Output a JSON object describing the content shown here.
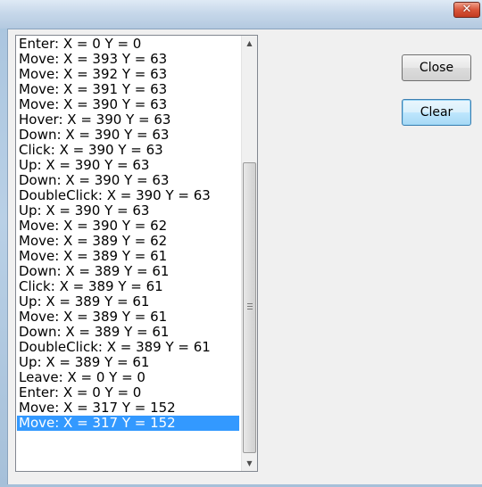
{
  "window": {
    "close_glyph": "✕"
  },
  "log": {
    "items": [
      "Enter: X = 0 Y = 0",
      "Move: X = 393 Y = 63",
      "Move: X = 392 Y = 63",
      "Move: X = 391 Y = 63",
      "Move: X = 390 Y = 63",
      "Hover: X = 390 Y = 63",
      "Down: X = 390 Y = 63",
      "Click: X = 390 Y = 63",
      "Up: X = 390 Y = 63",
      "Down: X = 390 Y = 63",
      "DoubleClick: X = 390 Y = 63",
      "Up: X = 390 Y = 63",
      "Move: X = 390 Y = 62",
      "Move: X = 389 Y = 62",
      "Move: X = 389 Y = 61",
      "Down: X = 389 Y = 61",
      "Click: X = 389 Y = 61",
      "Up: X = 389 Y = 61",
      "Move: X = 389 Y = 61",
      "Down: X = 389 Y = 61",
      "DoubleClick: X = 389 Y = 61",
      "Up: X = 389 Y = 61",
      "Leave: X = 0 Y = 0",
      "Enter: X = 0 Y = 0",
      "Move: X = 317 Y = 152",
      "Move: X = 317 Y = 152"
    ],
    "selected_index": 25
  },
  "buttons": {
    "close_label": "Close",
    "clear_label": "Clear"
  },
  "colors": {
    "selection": "#3399ff",
    "titlebar_close": "#d9553a"
  }
}
